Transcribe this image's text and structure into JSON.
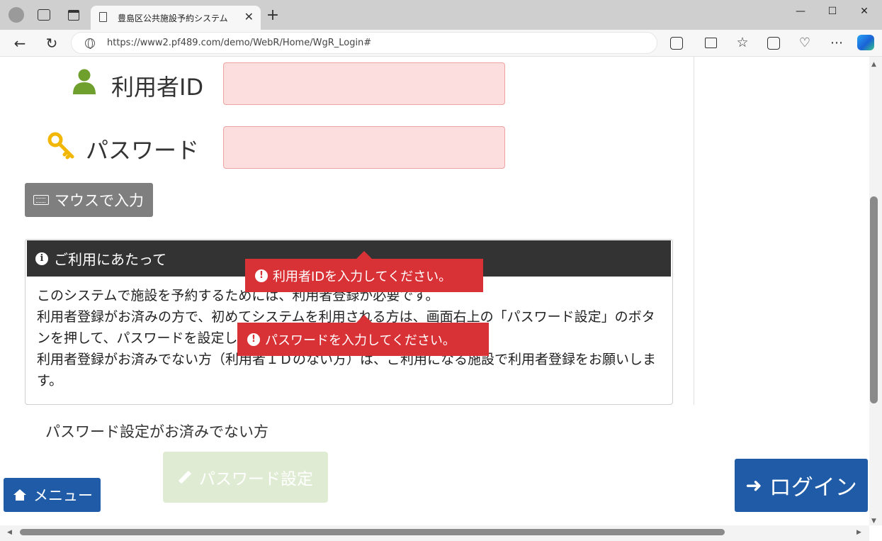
{
  "browser": {
    "tab_title": "豊島区公共施設予約システム",
    "url": "https://www2.pf489.com/demo/WebR/Home/WgR_Login#",
    "tab_close": "✕",
    "new_tab": "+",
    "back": "←",
    "reload": "↻",
    "minimize": "—",
    "maximize": "☐",
    "close": "✕"
  },
  "form": {
    "user_id_label": "利用者ID",
    "password_label": "パスワード",
    "mouse_input_label": "マウスで入力"
  },
  "notice": {
    "title": "ご利用にあたって",
    "lines": [
      "このシステムで施設を予約するためには、利用者登録が必要です。",
      "利用者登録がお済みの方で、初めてシステムを利用される方は、画面右上の「パスワード設定」のボタンを押して、パスワードを設定してください。",
      "利用者登録がお済みでない方（利用者ＩＤのない方）は、ご利用になる施設で利用者登録をお願いします。"
    ]
  },
  "errors": {
    "user_id": "利用者IDを入力してください。",
    "password": "パスワードを入力してください。"
  },
  "password_setup": {
    "note": "パスワード設定がお済みでない方",
    "button_label": "パスワード設定"
  },
  "nav": {
    "menu_label": "メニュー",
    "login_label": "ログイン"
  },
  "colors": {
    "input_error_bg": "#fcdede",
    "tooltip_red": "#d83237",
    "primary_blue": "#1f5ba7",
    "panel_header": "#333333",
    "disabled_green": "#dfecd3",
    "user_icon_green": "#6fa02e",
    "key_icon_yellow": "#f2b705"
  }
}
